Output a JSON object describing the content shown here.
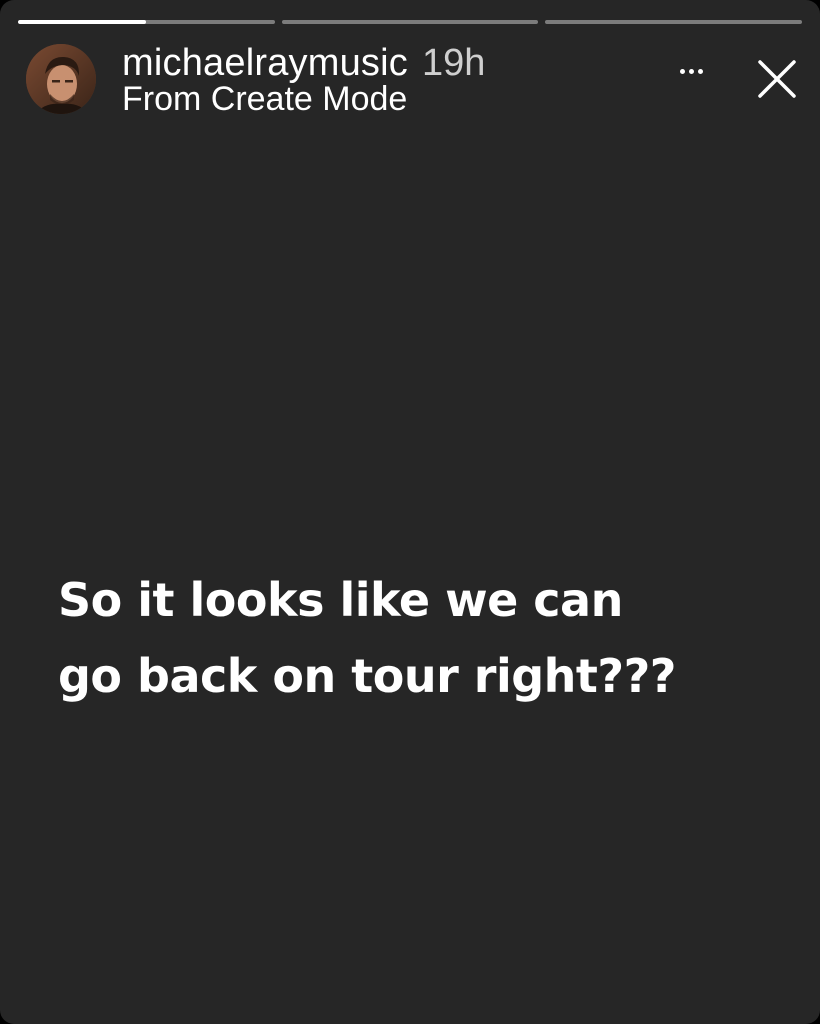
{
  "progress": {
    "segments": [
      {
        "filled_fraction": 0.5
      },
      {
        "filled_fraction": 0
      },
      {
        "filled_fraction": 0
      }
    ]
  },
  "header": {
    "username": "michaelraymusic",
    "time": "19h",
    "subtitle": "From Create Mode",
    "avatar_icon": "profile-photo"
  },
  "actions": {
    "more_icon": "more-horizontal-icon",
    "close_icon": "close-icon"
  },
  "story": {
    "line1": "So it looks like we can",
    "line2": "go back on tour right???"
  },
  "colors": {
    "background": "#262626",
    "text": "#ffffff"
  }
}
